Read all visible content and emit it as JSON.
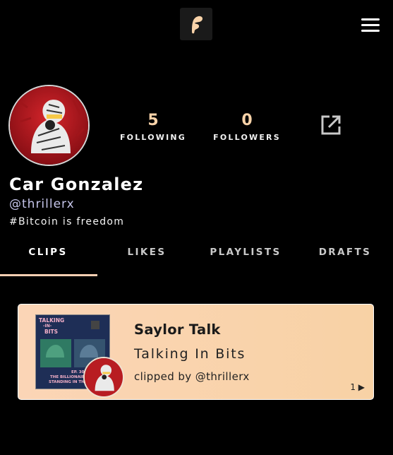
{
  "profile": {
    "name": "Car Gonzalez",
    "handle": "@thrillerx",
    "bio": "#Bitcoin is freedom",
    "following_count": "5",
    "following_label": "FOLLOWING",
    "followers_count": "0",
    "followers_label": "FOLLOWERS"
  },
  "tabs": [
    {
      "label": "CLIPS",
      "active": true
    },
    {
      "label": "LIKES",
      "active": false
    },
    {
      "label": "PLAYLISTS",
      "active": false
    },
    {
      "label": "DRAFTS",
      "active": false
    }
  ],
  "clip": {
    "title": "Saylor Talk",
    "show": "Talking In Bits",
    "clipped_by": "clipped by @thrillerx",
    "play_count": "1 ▶",
    "cover_text": {
      "line1": "TALKING",
      "line2": "-IN-",
      "line3": "BITS",
      "episode": "EP. 30",
      "caption1": "THE BILLIONAIRE",
      "caption2": "STANDING IN THE"
    }
  },
  "icons": {
    "logo": "app-logo-icon",
    "menu": "hamburger-menu-icon",
    "share": "external-link-icon"
  },
  "colors": {
    "accent": "#f9d3a9",
    "background": "#000000",
    "card_start": "#fbd5b6",
    "card_end": "#f8d2a5"
  }
}
